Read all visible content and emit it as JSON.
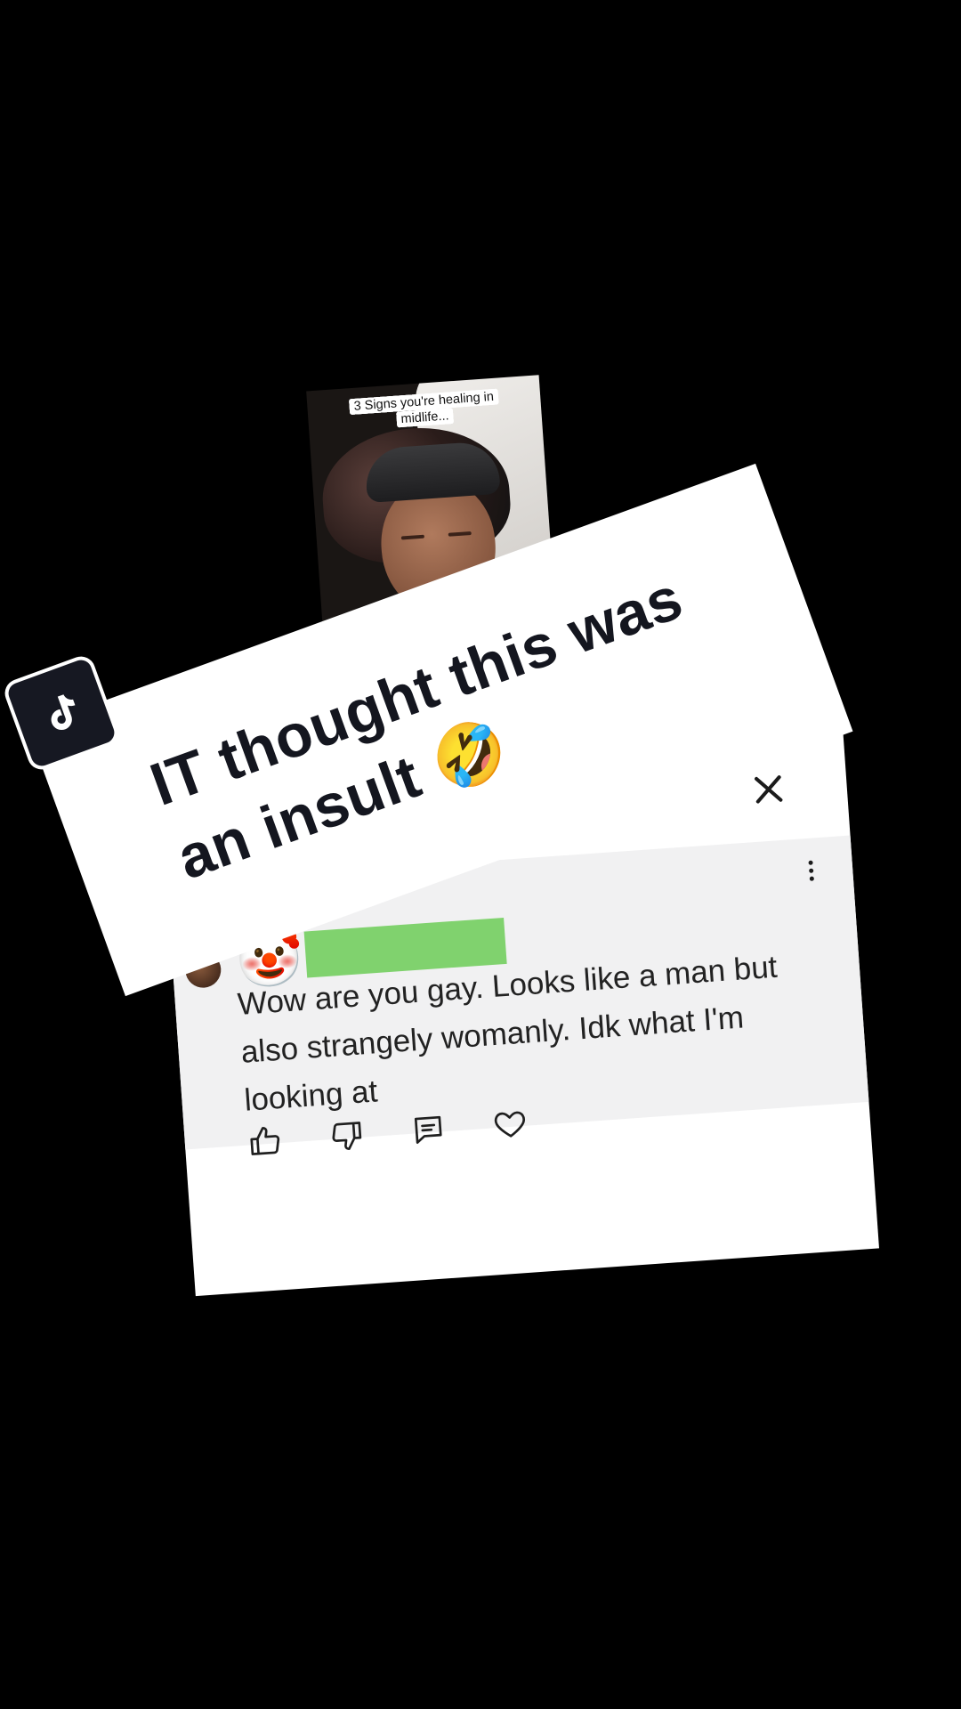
{
  "video": {
    "caption": "3 Signs you're healing in midlife..."
  },
  "banner": {
    "headline": "IT thought this was an insult 🤣"
  },
  "comment": {
    "avatar_emoji": "🤡",
    "text": "Wow are you gay. Looks like a man but also strangely womanly. Idk what I'm looking at"
  },
  "icons": {
    "brand": "tiktok-icon",
    "close": "close-icon",
    "more": "more-vertical-icon",
    "actions": [
      "thumbs-up-icon",
      "thumbs-down-icon",
      "reply-icon",
      "heart-icon"
    ]
  },
  "colors": {
    "background": "#000000",
    "card": "#ffffff",
    "comment_panel": "#f1f1f2",
    "redaction": "#80d26e",
    "headline_text": "#14161f"
  }
}
